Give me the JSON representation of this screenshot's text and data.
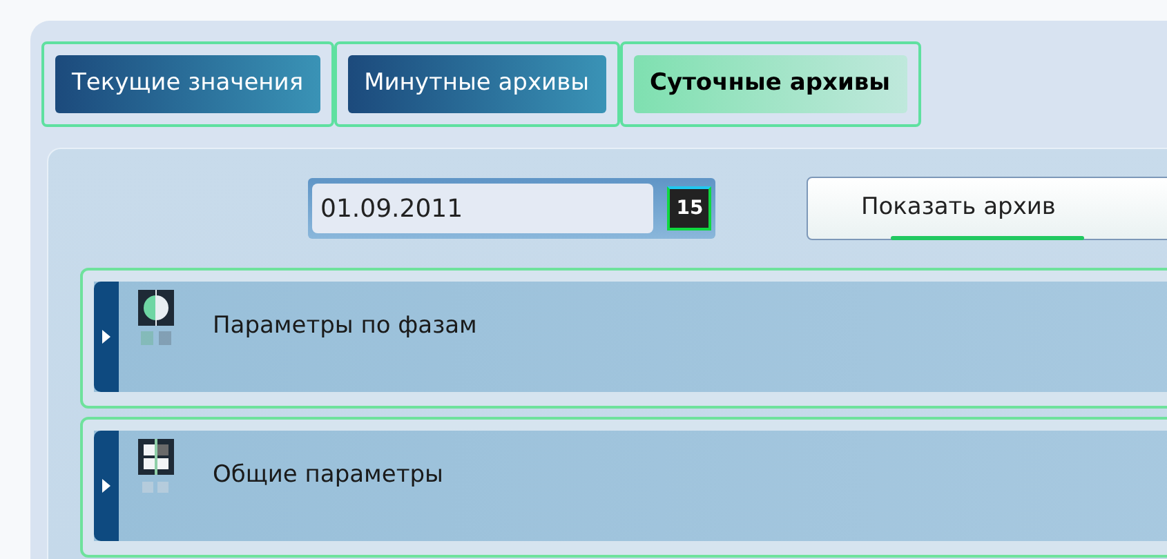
{
  "tabs": [
    {
      "label": "Текущие значения",
      "selected": false
    },
    {
      "label": "Минутные архивы",
      "selected": false
    },
    {
      "label": "Суточные архивы",
      "selected": true
    }
  ],
  "date_field": {
    "value": "01.09.2011",
    "calendar_day": "15"
  },
  "show_button": {
    "label": "Показать архив"
  },
  "sections": [
    {
      "title": "Параметры по фазам",
      "kind": "phases",
      "expanded": false
    },
    {
      "title": "Общие параметры",
      "kind": "grid",
      "expanded": false
    }
  ]
}
